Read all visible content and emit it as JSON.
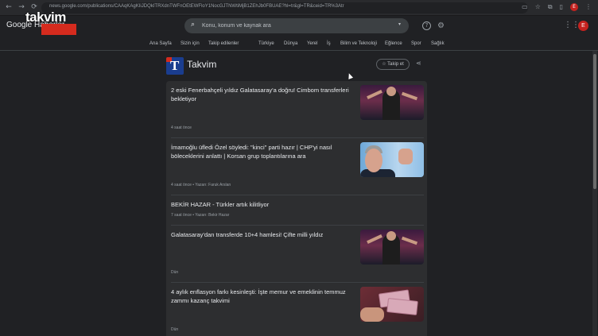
{
  "browser": {
    "url": "news.google.com/publications/CAAqKAgKIiJDQkITRXdnTWFnOEtEWFloY1NocGJTNWtiMjB1ZEhJb0FBUAE?hl=tr&gl=TR&ceid=TR%3Atr",
    "nav": {
      "back": "←",
      "forward": "→",
      "reload": "⟳"
    },
    "actions": {
      "cast": "▭",
      "bookmark": "☆",
      "extensions": "⧉",
      "sidebar": "▯",
      "menu": "⋮"
    },
    "avatar_letter": "E"
  },
  "watermark": {
    "text": "takvim",
    "sub": "TV"
  },
  "header": {
    "logo": "Google Haberler",
    "search": {
      "placeholder": "Konu, konum ve kaynak ara",
      "icon": "search-icon",
      "dropdown": "▾"
    },
    "help_icon": "?",
    "settings_icon": "⚙",
    "apps_icon": "⋮⋮⋮",
    "avatar_letter": "E"
  },
  "sections": [
    "Ana Sayfa",
    "Sizin için",
    "Takip edilenler",
    "Türkiye",
    "Dünya",
    "Yerel",
    "İş",
    "Bilim ve Teknoloji",
    "Eğlence",
    "Spor",
    "Sağlık"
  ],
  "publication": {
    "name": "Takvim",
    "logo_letter": "T",
    "follow_label": "☆ Takip et",
    "share_icon": "share-icon"
  },
  "articles": [
    {
      "title": "2 eski Fenerbahçeli yıldız Galatasaray'a doğru! Cimbom transferleri bekletiyor",
      "meta": "4 saat önce",
      "thumb": "crowd"
    },
    {
      "title": "İmamoğlu üfledi Özel söyledi: \"kinci\" parti hazır | CHP'yi nasıl böleceklerini anlattı | Korsan grup toplantılarına ara",
      "meta": "4 saat önce • Yazarı: Faruk Arslan",
      "thumb": "speaker"
    },
    {
      "title": "BEKİR HAZAR - Türkler artık kilitliyor",
      "meta": "7 saat önce • Yazarı: Bekir Hazar",
      "thumb": ""
    },
    {
      "title": "Galatasaray'dan transferde 10+4 hamlesi! Çifte milli yıldız",
      "meta": "Dün",
      "thumb": "crowd"
    },
    {
      "title": "4 aylık enflasyon farkı kesinleşti: İşte memur ve emeklinin temmuz zammı kazanç takvimi",
      "meta": "Dün",
      "thumb": "money"
    }
  ]
}
